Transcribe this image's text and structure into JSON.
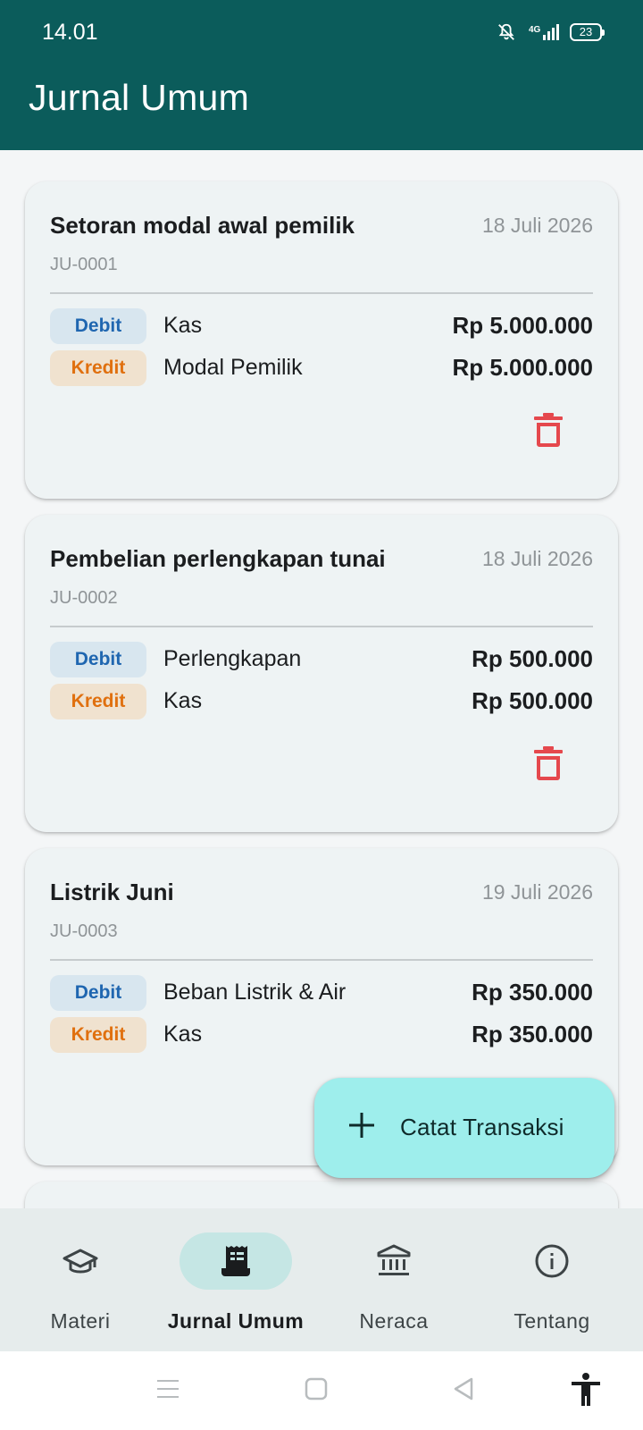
{
  "status_bar": {
    "time": "14.01",
    "network": "4G",
    "battery": "23"
  },
  "app_bar": {
    "title": "Jurnal Umum"
  },
  "transactions": [
    {
      "title": "Setoran modal awal pemilik",
      "date": "18 Juli 2026",
      "code": "JU-0001",
      "entries": [
        {
          "type": "Debit",
          "account": "Kas",
          "amount": "Rp 5.000.000"
        },
        {
          "type": "Kredit",
          "account": "Modal Pemilik",
          "amount": "Rp 5.000.000"
        }
      ]
    },
    {
      "title": "Pembelian perlengkapan tunai",
      "date": "18 Juli 2026",
      "code": "JU-0002",
      "entries": [
        {
          "type": "Debit",
          "account": "Perlengkapan",
          "amount": "Rp 500.000"
        },
        {
          "type": "Kredit",
          "account": "Kas",
          "amount": "Rp 500.000"
        }
      ]
    },
    {
      "title": "Listrik Juni",
      "date": "19 Juli 2026",
      "code": "JU-0003",
      "entries": [
        {
          "type": "Debit",
          "account": "Beban Listrik & Air",
          "amount": "Rp 350.000"
        },
        {
          "type": "Kredit",
          "account": "Kas",
          "amount": "Rp 350.000"
        }
      ]
    }
  ],
  "fab": {
    "label": "Catat Transaksi",
    "icon": "plus-icon"
  },
  "bottom_nav": {
    "items": [
      {
        "label": "Materi",
        "icon": "graduation-cap-icon",
        "active": false
      },
      {
        "label": "Jurnal Umum",
        "icon": "receipt-icon",
        "active": true
      },
      {
        "label": "Neraca",
        "icon": "bank-icon",
        "active": false
      },
      {
        "label": "Tentang",
        "icon": "info-icon",
        "active": false
      }
    ]
  },
  "colors": {
    "primary": "#0b5c5b",
    "fab": "#9eeeec",
    "debit_text": "#1f66b0",
    "kredit_text": "#e0700f",
    "delete": "#e5484d",
    "nav_active_pill": "#c5e6e4"
  }
}
